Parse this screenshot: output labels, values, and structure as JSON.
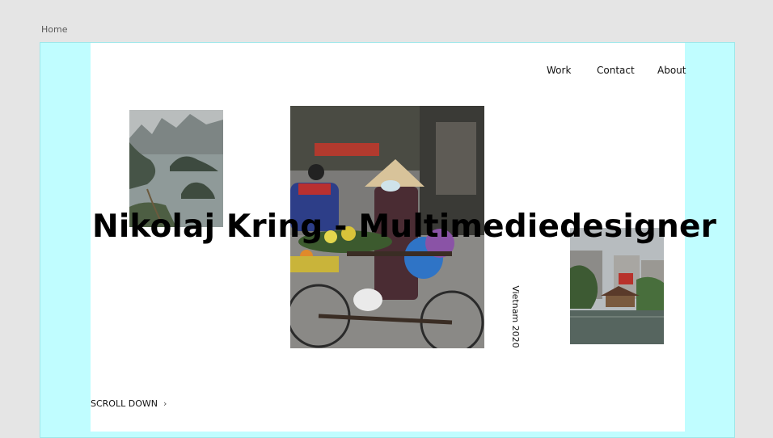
{
  "canvas": {
    "page_label": "Home"
  },
  "nav": {
    "items": [
      {
        "label": "Work"
      },
      {
        "label": "Contact"
      },
      {
        "label": "About"
      }
    ]
  },
  "hero": {
    "headline": "Nikolaj Kring - Multimediedesigner",
    "photo_caption": "Vietnam 2020",
    "scroll_label": "SCROLL DOWN",
    "scroll_icon": "chevron-right-icon"
  },
  "colors": {
    "artboard_bg": "#c0fdff",
    "content_bg": "#ffffff",
    "canvas_bg": "#e5e5e5",
    "text": "#000000"
  }
}
